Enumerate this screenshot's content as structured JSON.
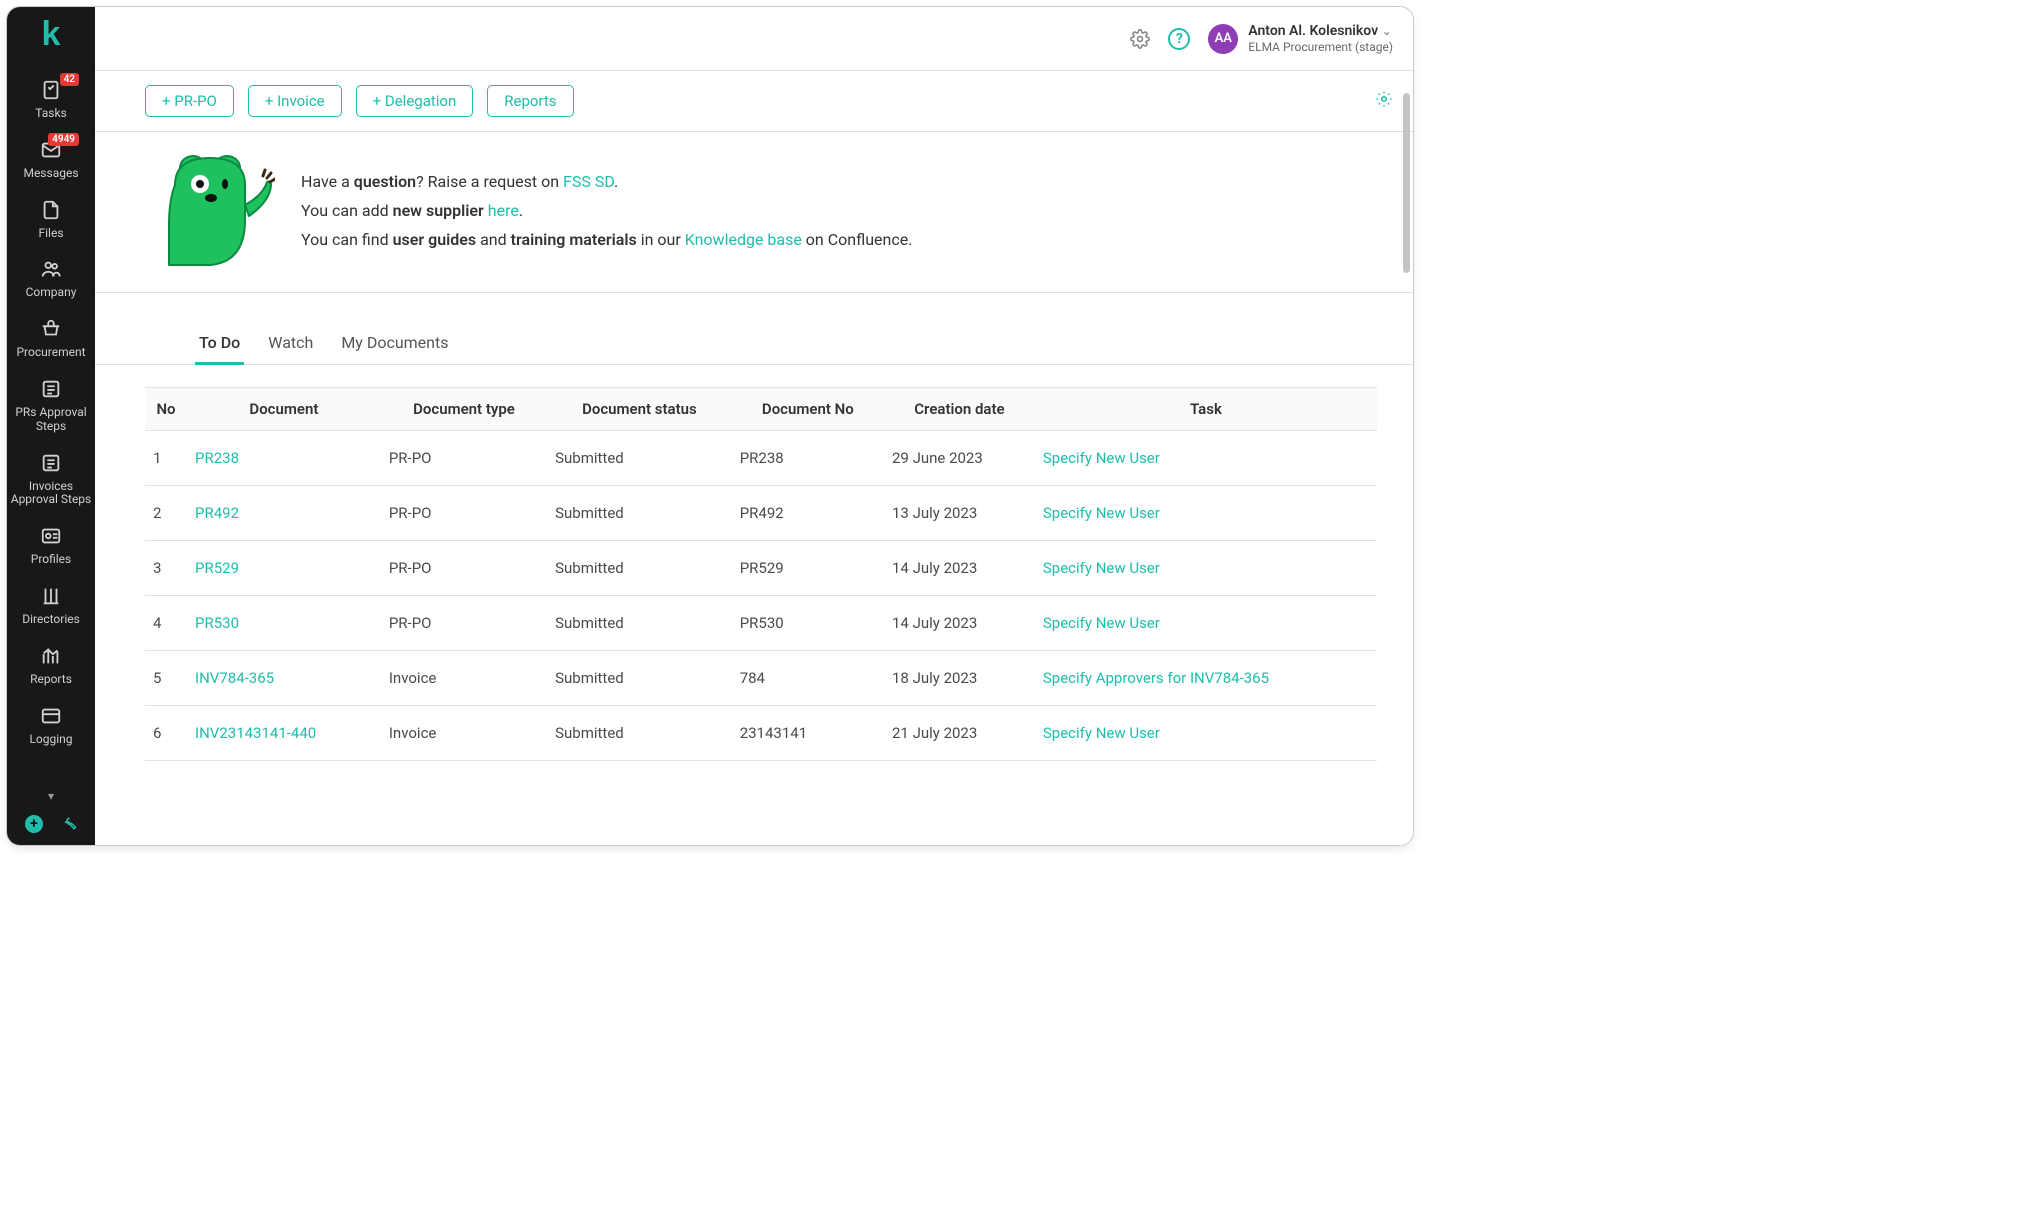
{
  "brand": {
    "logo_letter": "k"
  },
  "user": {
    "name": "Anton Al. Kolesnikov",
    "initials": "AA",
    "subtitle": "ELMA Procurement (stage)"
  },
  "sidebar": {
    "items": [
      {
        "label": "Tasks",
        "badge": "42"
      },
      {
        "label": "Messages",
        "badge": "4949"
      },
      {
        "label": "Files"
      },
      {
        "label": "Company"
      },
      {
        "label": "Procurement"
      },
      {
        "label": "PRs Approval Steps"
      },
      {
        "label": "Invoices Approval Steps"
      },
      {
        "label": "Profiles"
      },
      {
        "label": "Directories"
      },
      {
        "label": "Reports"
      },
      {
        "label": "Logging"
      }
    ]
  },
  "actions": {
    "prpo": "+ PR-PO",
    "invoice": "+ Invoice",
    "delegation": "+ Delegation",
    "reports": "Reports"
  },
  "hero": {
    "l1_a": "Have a ",
    "l1_b": "question",
    "l1_c": "? Raise a request on ",
    "l1_link": "FSS SD",
    "l1_d": ".",
    "l2_a": "You can add ",
    "l2_b": "new supplier",
    "l2_c": " ",
    "l2_link": "here",
    "l2_d": ".",
    "l3_a": "You can find ",
    "l3_b": "user guides",
    "l3_c": " and ",
    "l3_d": "training materials",
    "l3_e": " in our ",
    "l3_link": "Knowledge base",
    "l3_f": " on Confluence."
  },
  "tabs": {
    "todo": "To Do",
    "watch": "Watch",
    "mydocs": "My Documents"
  },
  "table": {
    "headers": {
      "no": "No",
      "doc": "Document",
      "type": "Document type",
      "status": "Document status",
      "docno": "Document No",
      "date": "Creation date",
      "task": "Task"
    },
    "rows": [
      {
        "no": "1",
        "doc": "PR238",
        "type": "PR-PO",
        "status": "Submitted",
        "docno": "PR238",
        "date": "29 June 2023",
        "task": "Specify New User"
      },
      {
        "no": "2",
        "doc": "PR492",
        "type": "PR-PO",
        "status": "Submitted",
        "docno": "PR492",
        "date": "13 July 2023",
        "task": "Specify New User"
      },
      {
        "no": "3",
        "doc": "PR529",
        "type": "PR-PO",
        "status": "Submitted",
        "docno": "PR529",
        "date": "14 July 2023",
        "task": "Specify New User"
      },
      {
        "no": "4",
        "doc": "PR530",
        "type": "PR-PO",
        "status": "Submitted",
        "docno": "PR530",
        "date": "14 July 2023",
        "task": "Specify New User"
      },
      {
        "no": "5",
        "doc": "INV784-365",
        "type": "Invoice",
        "status": "Submitted",
        "docno": "784",
        "date": "18 July 2023",
        "task": "Specify Approvers for INV784-365"
      },
      {
        "no": "6",
        "doc": "INV23143141-440",
        "type": "Invoice",
        "status": "Submitted",
        "docno": "23143141",
        "date": "21 July 2023",
        "task": "Specify New User"
      }
    ]
  }
}
